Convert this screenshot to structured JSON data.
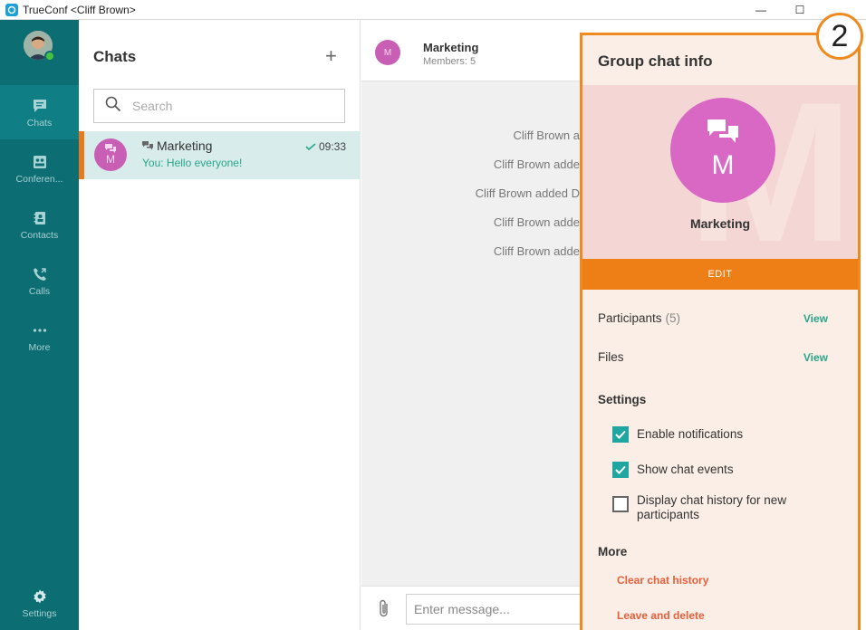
{
  "window": {
    "title": "TrueConf <Cliff Brown>",
    "minimize_glyph": "—",
    "maximize_glyph": "☐"
  },
  "nav": {
    "items": [
      {
        "label": "Chats",
        "icon": "chat-icon"
      },
      {
        "label": "Conferen...",
        "icon": "conference-icon"
      },
      {
        "label": "Contacts",
        "icon": "contacts-icon"
      },
      {
        "label": "Calls",
        "icon": "calls-icon"
      },
      {
        "label": "More",
        "icon": "more-icon"
      }
    ],
    "settings_label": "Settings"
  },
  "chats": {
    "title": "Chats",
    "add_glyph": "+",
    "search_placeholder": "Search",
    "list": [
      {
        "avatar_letter": "M",
        "name": "Marketing",
        "message": "You: Hello everyone!",
        "time": "09:33"
      }
    ]
  },
  "conversation": {
    "name": "Marketing",
    "members": "Members: 5",
    "avatar_letter": "M",
    "events": [
      "Cliff Brown a",
      "Cliff Brown adde",
      "Cliff Brown added D",
      "Cliff Brown adde",
      "Cliff Brown adde"
    ],
    "composer_placeholder": "Enter message..."
  },
  "info": {
    "title": "Group chat info",
    "avatar_letter": "M",
    "group_name": "Marketing",
    "edit_label": "EDIT",
    "participants_label": "Participants",
    "participants_count": "(5)",
    "files_label": "Files",
    "view_label": "View",
    "settings_heading": "Settings",
    "options": [
      {
        "label": "Enable notifications",
        "checked": true
      },
      {
        "label": "Show chat events",
        "checked": true
      },
      {
        "label": "Display chat history for new participants",
        "checked": false
      }
    ],
    "more_heading": "More",
    "clear_history": "Clear chat history",
    "leave_delete": "Leave and delete"
  },
  "callout": {
    "number": "2"
  },
  "colors": {
    "teal": "#0c6e73",
    "accent_orange": "#ee7e16",
    "group_avatar": "#d967c4",
    "link_teal": "#2aa58c",
    "danger": "#e5603c"
  }
}
